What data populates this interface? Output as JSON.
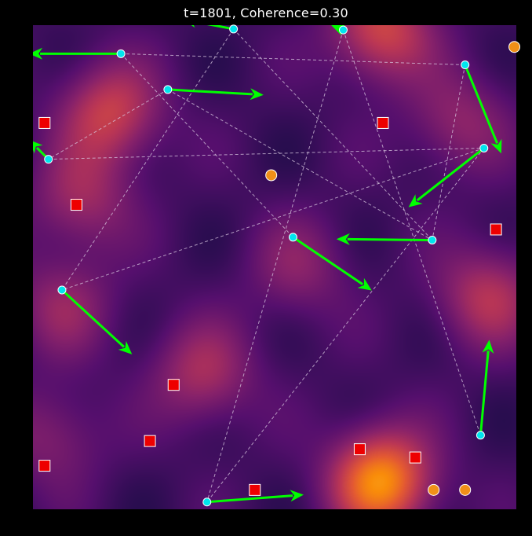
{
  "chart_data": {
    "type": "scatter",
    "title": "t=1801, Coherence=0.30",
    "xlabel": "",
    "ylabel": "",
    "xlim": [
      0,
      100
    ],
    "ylim": [
      0,
      100
    ],
    "grid": false,
    "axes_visible": false,
    "background": {
      "colormap": "inferno",
      "peaks": [
        {
          "x": 72,
          "y": 6,
          "intensity": 1.0
        },
        {
          "x": 72,
          "y": 99,
          "intensity": 0.65
        },
        {
          "x": 16,
          "y": 82,
          "intensity": 0.6
        },
        {
          "x": 94,
          "y": 44,
          "intensity": 0.5
        },
        {
          "x": 35,
          "y": 28,
          "intensity": 0.45
        },
        {
          "x": 10,
          "y": 64,
          "intensity": 0.4
        },
        {
          "x": 6,
          "y": 42,
          "intensity": 0.35
        },
        {
          "x": 88,
          "y": 80,
          "intensity": 0.35
        },
        {
          "x": 55,
          "y": 50,
          "intensity": 0.3
        },
        {
          "x": 4,
          "y": 15,
          "intensity": 0.3
        }
      ]
    },
    "agents": [
      {
        "x": 41.5,
        "y": 99.2,
        "dx": -10.5,
        "dy": 2.0
      },
      {
        "x": 64.2,
        "y": 99.0,
        "dx": -2.5,
        "dy": 1.0
      },
      {
        "x": 18.2,
        "y": 94.1,
        "dx": -19.0,
        "dy": 0.0
      },
      {
        "x": 89.4,
        "y": 91.8,
        "dx": 7.5,
        "dy": -18.3
      },
      {
        "x": 27.9,
        "y": 86.7,
        "dx": 19.8,
        "dy": -1.1
      },
      {
        "x": 3.2,
        "y": 72.3,
        "dx": -4.0,
        "dy": 4.0
      },
      {
        "x": 93.3,
        "y": 74.6,
        "dx": -15.6,
        "dy": -12.2
      },
      {
        "x": 53.8,
        "y": 56.2,
        "dx": 16.3,
        "dy": -11.0
      },
      {
        "x": 82.6,
        "y": 55.6,
        "dx": -19.8,
        "dy": 0.2
      },
      {
        "x": 6.0,
        "y": 45.3,
        "dx": 14.5,
        "dy": -13.3
      },
      {
        "x": 92.6,
        "y": 15.3,
        "dx": 1.8,
        "dy": 19.7
      },
      {
        "x": 36.0,
        "y": 1.5,
        "dx": 20.0,
        "dy": 1.5
      }
    ],
    "links": [
      [
        2,
        3
      ],
      [
        4,
        5
      ],
      [
        5,
        6
      ],
      [
        6,
        9
      ],
      [
        0,
        9
      ],
      [
        0,
        8
      ],
      [
        2,
        7
      ],
      [
        4,
        8
      ],
      [
        1,
        11
      ],
      [
        6,
        11
      ],
      [
        1,
        10
      ],
      [
        3,
        8
      ]
    ],
    "targets": [
      {
        "x": 2.4,
        "y": 79.8
      },
      {
        "x": 72.4,
        "y": 79.8
      },
      {
        "x": 9.0,
        "y": 62.9
      },
      {
        "x": 95.8,
        "y": 57.8
      },
      {
        "x": 29.1,
        "y": 25.7
      },
      {
        "x": 24.2,
        "y": 14.1
      },
      {
        "x": 2.4,
        "y": 9.0
      },
      {
        "x": 67.6,
        "y": 12.4
      },
      {
        "x": 79.1,
        "y": 10.7
      },
      {
        "x": 45.9,
        "y": 4.0
      }
    ],
    "resources": [
      {
        "x": 99.6,
        "y": 95.5
      },
      {
        "x": 49.3,
        "y": 69.0
      },
      {
        "x": 82.9,
        "y": 4.0
      },
      {
        "x": 89.4,
        "y": 4.0
      }
    ]
  },
  "colors": {
    "agent_fill": "#00e5ee",
    "agent_edge": "#ffffff",
    "arrow": "#00ff00",
    "link": "#d8c8e0",
    "target_fill": "#ee0000",
    "target_edge": "#ffffff",
    "resource_fill": "#f09018",
    "resource_edge": "#ffffff",
    "page_bg": "#000000"
  }
}
